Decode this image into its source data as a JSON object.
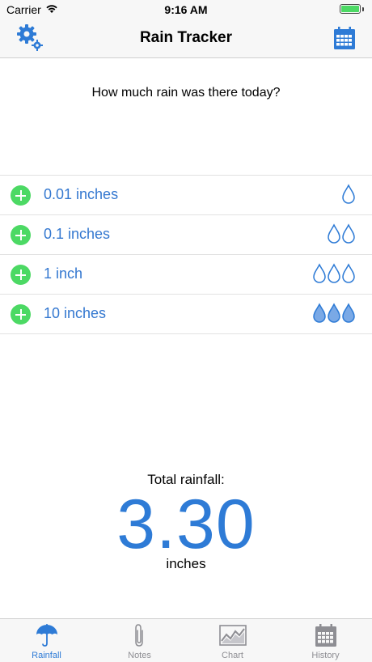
{
  "status_bar": {
    "carrier": "Carrier",
    "time": "9:16 AM"
  },
  "nav": {
    "title": "Rain Tracker"
  },
  "prompt": "How much rain was there today?",
  "amounts": [
    {
      "label": "0.01 inches",
      "drops": 1,
      "filled": false
    },
    {
      "label": "0.1 inches",
      "drops": 2,
      "filled": false
    },
    {
      "label": "1 inch",
      "drops": 3,
      "filled": false
    },
    {
      "label": "10 inches",
      "drops": 3,
      "filled": true
    }
  ],
  "total": {
    "label": "Total rainfall:",
    "value": "3.30",
    "unit": "inches"
  },
  "tabs": [
    {
      "label": "Rainfall",
      "icon": "umbrella-icon",
      "active": true
    },
    {
      "label": "Notes",
      "icon": "paperclip-icon",
      "active": false
    },
    {
      "label": "Chart",
      "icon": "chart-icon",
      "active": false
    },
    {
      "label": "History",
      "icon": "calendar-icon",
      "active": false
    }
  ],
  "colors": {
    "accent": "#2e7bd6",
    "add_button": "#4cd964",
    "tab_inactive": "#8e8e93"
  }
}
